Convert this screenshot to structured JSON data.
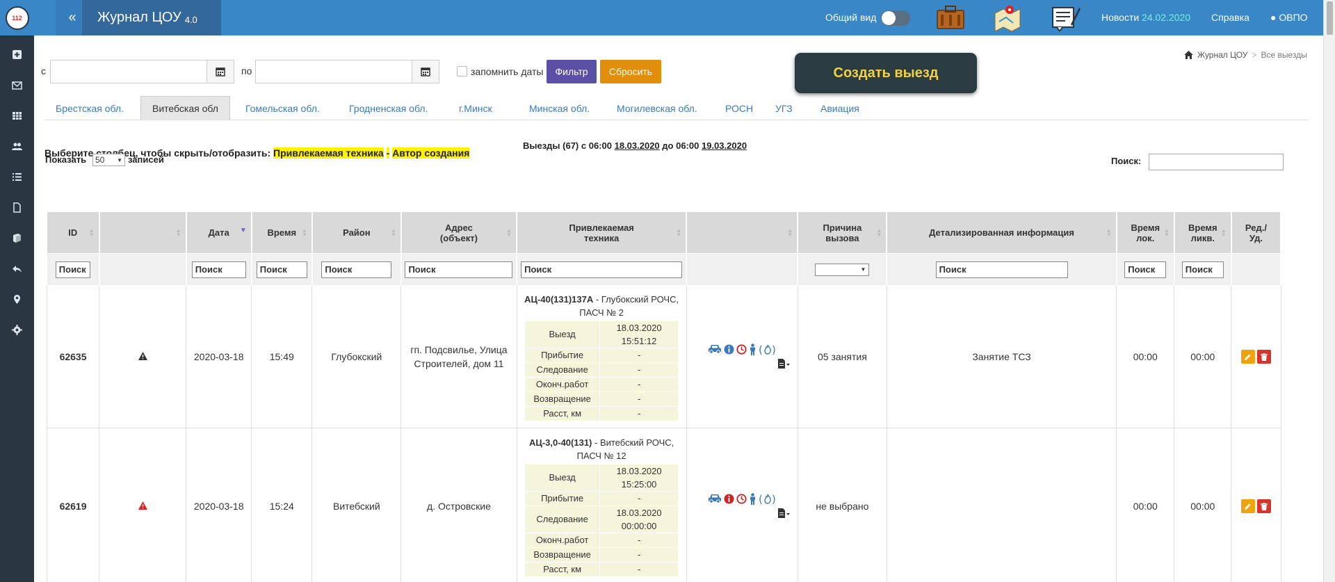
{
  "app": {
    "logo_text": "112",
    "collapse_icon": "«",
    "title": "Журнал ЦОУ",
    "version": "4.0",
    "brand_color": "#3a87c8"
  },
  "topbar": {
    "toggle_label": "Общий вид",
    "icons": [
      "briefcase-icon",
      "map-icon",
      "notepad-icon"
    ],
    "news_label": "Новости",
    "news_date": "24.02.2020",
    "help_label": "Справка",
    "user_label": "ОВПО"
  },
  "sidebar": {
    "items": [
      "plus-icon",
      "mail-icon",
      "table-icon",
      "users-icon",
      "list-icon",
      "file-icon",
      "book-icon",
      "reply-icon",
      "map-marker-icon",
      "settings-icon"
    ]
  },
  "filter": {
    "from_label": "с",
    "to_label": "по",
    "from_value": "",
    "to_value": "",
    "remember_label": "запомнить даты",
    "remember_checked": false,
    "filter_button": "Фильтр",
    "reset_button": "Сбросить",
    "filter_color": "#5a50a5",
    "reset_color": "#e08e0b"
  },
  "create_button": "Создать выезд",
  "breadcrumb": {
    "home": "Журнал ЦОУ",
    "separator": ">",
    "current": "Все выезды"
  },
  "tabs": [
    {
      "label": "Брестская обл.",
      "active": false
    },
    {
      "label": "Витебская обл",
      "active": true
    },
    {
      "label": "Гомельская обл.",
      "active": false
    },
    {
      "label": "Гродненская обл.",
      "active": false
    },
    {
      "label": "г.Минск",
      "active": false
    },
    {
      "label": "Минская обл.",
      "active": false
    },
    {
      "label": "Могилевская обл.",
      "active": false
    },
    {
      "label": "РОСН",
      "active": false
    },
    {
      "label": "УГЗ",
      "active": false
    },
    {
      "label": "Авиация",
      "active": false
    }
  ],
  "column_toggle": {
    "prompt": "Выберите столбец, чтобы скрыть/отобразить:",
    "col1": "Привлекаемая техника",
    "sep": "-",
    "col2": "Автор создания"
  },
  "summary": {
    "text1": "Выезды (67) с 06:00",
    "date1": "18.03.2020",
    "text2": "до 06:00",
    "date2": "19.03.2020"
  },
  "length": {
    "show_label": "Показать",
    "value": "50",
    "records_label": "записей"
  },
  "search": {
    "label": "Поиск:",
    "value": ""
  },
  "table": {
    "headers": [
      "ID",
      "",
      "Дата",
      "Время",
      "Район",
      "Адрес\n(объект)",
      "Привлекаемая\nтехника",
      "",
      "Причина\nвызова",
      "Детализированная информация",
      "Время\nлок.",
      "Время\nликв.",
      "Ред./\nУд."
    ],
    "filter_placeholder": "Поиск",
    "rows": [
      {
        "id": "62635",
        "alert_color": "#333333",
        "date": "2020-03-18",
        "time": "15:49",
        "district": "Глубокский",
        "address": "гп. Подсвилье, Улица Строителей, дом 11",
        "vehicle_code": "АЦ-40(131)137А",
        "vehicle_rest": "- Глубокский РОЧС, ПАСЧ № 2",
        "times": [
          {
            "k": "Выезд",
            "v": "18.03.2020 15:51:12"
          },
          {
            "k": "Прибытие",
            "v": "-"
          },
          {
            "k": "Следование",
            "v": "-"
          },
          {
            "k": "Оконч.работ",
            "v": "-"
          },
          {
            "k": "Возвращение",
            "v": "-"
          },
          {
            "k": "Расст, км",
            "v": "-"
          }
        ],
        "reason": "05 занятия",
        "details": "Занятие ТСЗ",
        "loc_time": "00:00",
        "liq_time": "00:00"
      },
      {
        "id": "62619",
        "alert_color": "#e02020",
        "date": "2020-03-18",
        "time": "15:24",
        "district": "Витебский",
        "address": "д. Островские",
        "vehicle_code": "АЦ-3,0-40(131)",
        "vehicle_rest": "- Витебский РОЧС, ПАСЧ № 12",
        "times": [
          {
            "k": "Выезд",
            "v": "18.03.2020 15:25:00"
          },
          {
            "k": "Прибытие",
            "v": "-"
          },
          {
            "k": "Следование",
            "v": "18.03.2020 00:00:00"
          },
          {
            "k": "Оконч.работ",
            "v": "-"
          },
          {
            "k": "Возвращение",
            "v": "-"
          },
          {
            "k": "Расст, км",
            "v": "-"
          }
        ],
        "reason": "не выбрано",
        "details": "",
        "loc_time": "00:00",
        "liq_time": "00:00"
      }
    ]
  }
}
